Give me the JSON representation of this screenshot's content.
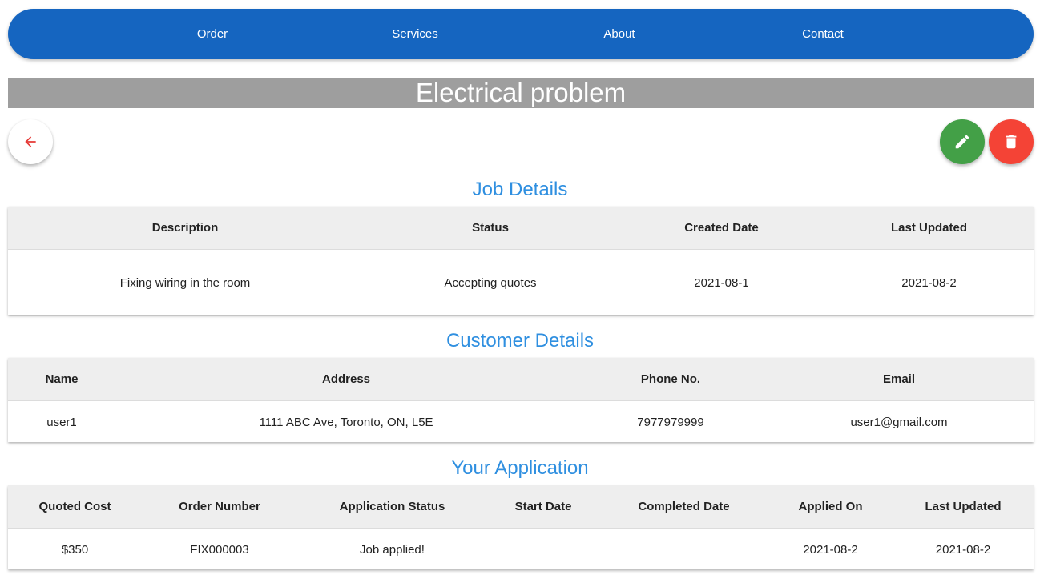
{
  "nav": {
    "items": [
      "Order",
      "Services",
      "About",
      "Contact"
    ]
  },
  "page": {
    "title": "Electrical problem"
  },
  "icons": {
    "back": "arrow-left-icon",
    "edit": "pencil-icon",
    "delete": "trash-icon"
  },
  "colors": {
    "navbar": "#1565c0",
    "section_title": "#2f8fe0",
    "edit_button": "#43a047",
    "delete_button": "#f44336",
    "back_arrow": "#e53935",
    "title_bar": "#9e9e9e"
  },
  "job_details": {
    "title": "Job Details",
    "headers": [
      "Description",
      "Status",
      "Created Date",
      "Last Updated"
    ],
    "rows": [
      [
        "Fixing wiring in the room",
        "Accepting quotes",
        "2021-08-1",
        "2021-08-2"
      ]
    ]
  },
  "customer_details": {
    "title": "Customer Details",
    "headers": [
      "Name",
      "Address",
      "Phone No.",
      "Email"
    ],
    "rows": [
      [
        "user1",
        "1111 ABC Ave, Toronto, ON, L5E",
        "7977979999",
        "user1@gmail.com"
      ]
    ]
  },
  "application": {
    "title": "Your Application",
    "headers": [
      "Quoted Cost",
      "Order Number",
      "Application Status",
      "Start Date",
      "Completed Date",
      "Applied On",
      "Last Updated"
    ],
    "rows": [
      [
        "$350",
        "FIX000003",
        "Job applied!",
        "",
        "",
        "2021-08-2",
        "2021-08-2"
      ]
    ]
  }
}
